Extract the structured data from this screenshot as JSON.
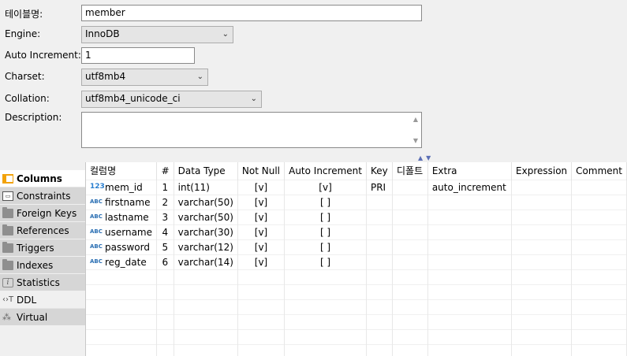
{
  "form": {
    "table_name_label": "테이블명:",
    "table_name_value": "member",
    "engine_label": "Engine:",
    "engine_value": "InnoDB",
    "auto_increment_label": "Auto Increment:",
    "auto_increment_value": "1",
    "charset_label": "Charset:",
    "charset_value": "utf8mb4",
    "collation_label": "Collation:",
    "collation_value": "utf8mb4_unicode_ci",
    "description_label": "Description:",
    "description_value": ""
  },
  "sidebar": {
    "items": [
      {
        "label": "Columns",
        "icon": "columns-icon",
        "state": "active"
      },
      {
        "label": "Constraints",
        "icon": "constraints-icon",
        "state": "inactive"
      },
      {
        "label": "Foreign Keys",
        "icon": "folder-icon",
        "state": "inactive"
      },
      {
        "label": "References",
        "icon": "folder-icon",
        "state": "inactive"
      },
      {
        "label": "Triggers",
        "icon": "folder-icon",
        "state": "inactive"
      },
      {
        "label": "Indexes",
        "icon": "folder-icon",
        "state": "inactive"
      },
      {
        "label": "Statistics",
        "icon": "info-icon",
        "state": "inactive"
      },
      {
        "label": "DDL",
        "icon": "ddl-icon",
        "state": "plain"
      },
      {
        "label": "Virtual",
        "icon": "virtual-icon",
        "state": "inactive"
      }
    ]
  },
  "grid": {
    "headers": [
      "컬럼명",
      "#",
      "Data Type",
      "Not Null",
      "Auto Increment",
      "Key",
      "디폴트",
      "Extra",
      "Expression",
      "Comment"
    ],
    "rows": [
      {
        "icon": "numeric-icon",
        "icon_text": "123",
        "name": "mem_id",
        "num": "1",
        "type": "int(11)",
        "not_null": "[v]",
        "auto_inc": "[v]",
        "key": "PRI",
        "default": "",
        "extra": "auto_increment",
        "expression": "",
        "comment": ""
      },
      {
        "icon": "text-icon",
        "icon_text": "ABC",
        "name": "firstname",
        "num": "2",
        "type": "varchar(50)",
        "not_null": "[v]",
        "auto_inc": "[ ]",
        "key": "",
        "default": "",
        "extra": "",
        "expression": "",
        "comment": ""
      },
      {
        "icon": "text-icon",
        "icon_text": "ABC",
        "name": "lastname",
        "num": "3",
        "type": "varchar(50)",
        "not_null": "[v]",
        "auto_inc": "[ ]",
        "key": "",
        "default": "",
        "extra": "",
        "expression": "",
        "comment": ""
      },
      {
        "icon": "text-icon",
        "icon_text": "ABC",
        "name": "username",
        "num": "4",
        "type": "varchar(30)",
        "not_null": "[v]",
        "auto_inc": "[ ]",
        "key": "",
        "default": "",
        "extra": "",
        "expression": "",
        "comment": ""
      },
      {
        "icon": "text-icon",
        "icon_text": "ABC",
        "name": "password",
        "num": "5",
        "type": "varchar(12)",
        "not_null": "[v]",
        "auto_inc": "[ ]",
        "key": "",
        "default": "",
        "extra": "",
        "expression": "",
        "comment": ""
      },
      {
        "icon": "text-icon",
        "icon_text": "ABC",
        "name": "reg_date",
        "num": "6",
        "type": "varchar(14)",
        "not_null": "[v]",
        "auto_inc": "[ ]",
        "key": "",
        "default": "",
        "extra": "",
        "expression": "",
        "comment": ""
      }
    ]
  }
}
